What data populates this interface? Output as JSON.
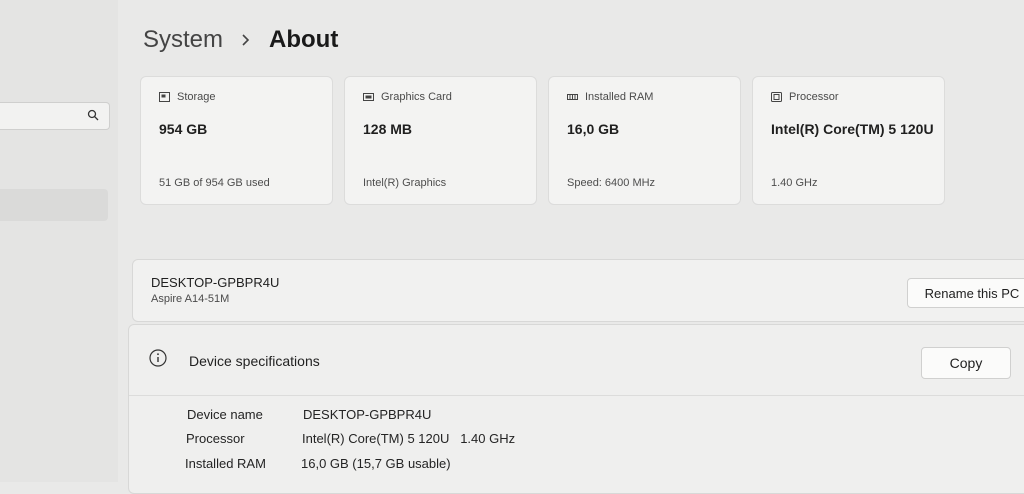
{
  "breadcrumb": {
    "parent": "System",
    "current": "About"
  },
  "cards": [
    {
      "icon": "storage-icon",
      "label": "Storage",
      "value": "954 GB",
      "sub": "51 GB of 954 GB used"
    },
    {
      "icon": "graphics-card-icon",
      "label": "Graphics Card",
      "value": "128 MB",
      "sub": "Intel(R) Graphics"
    },
    {
      "icon": "ram-icon",
      "label": "Installed RAM",
      "value": "16,0 GB",
      "sub": "Speed: 6400 MHz"
    },
    {
      "icon": "processor-icon",
      "label": "Processor",
      "value": "Intel(R) Core(TM) 5 120U",
      "sub": "1.40 GHz"
    }
  ],
  "pc": {
    "name": "DESKTOP-GPBPR4U",
    "model": "Aspire A14-51M",
    "rename_label": "Rename this PC"
  },
  "specs": {
    "title": "Device specifications",
    "copy_label": "Copy",
    "rows": [
      {
        "key": "Device name",
        "value": "DESKTOP-GPBPR4U"
      },
      {
        "key": "Processor",
        "value": "Intel(R) Core(TM) 5 120U   1.40 GHz"
      },
      {
        "key": "Installed RAM",
        "value": "16,0 GB (15,7 GB usable)"
      }
    ]
  }
}
